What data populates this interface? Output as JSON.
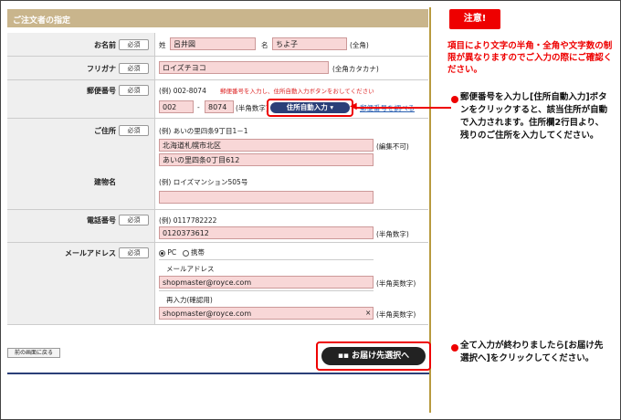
{
  "header": {
    "title": "ご注文者の指定"
  },
  "required_label": "必須",
  "name": {
    "label": "お名前",
    "sei_label": "姓",
    "sei_value": "呂井図",
    "mei_label": "名",
    "mei_value": "ちよ子",
    "hint": "(全角)"
  },
  "kana": {
    "label": "フリガナ",
    "value": "ロイズチヨコ",
    "hint": "(全角カタカナ)"
  },
  "postal": {
    "label": "郵便番号",
    "example": "(例) 002-8074",
    "instruction": "郵便番号を入力し、住所自動入力ボタンをおしてください",
    "value1": "002",
    "dash": "-",
    "value2": "8074",
    "hint": "(半角数字)",
    "auto_button": "住所自動入力",
    "lookup_link": "郵便番号を調べる"
  },
  "address": {
    "label": "ご住所",
    "example": "(例) あいの里四条9丁目1－1",
    "line1": "北海道札幌市北区",
    "line1_hint": "(編集不可)",
    "line2": "あいの里四条0丁目612",
    "building_label": "建物名",
    "building_example": "(例) ロイズマンション505号",
    "building_value": ""
  },
  "phone": {
    "label": "電話番号",
    "example": "(例) 0117782222",
    "value": "0120373612",
    "hint": "(半角数字)"
  },
  "email": {
    "label": "メールアドレス",
    "radio_pc": "PC",
    "radio_mobile": "携帯",
    "field_label": "メールアドレス",
    "value": "shopmaster@royce.com",
    "hint": "(半角英数字)",
    "confirm_label": "再入力(確認用)",
    "confirm_value": "shopmaster@royce.com",
    "confirm_hint": "(半角英数字)",
    "clear_glyph": "×"
  },
  "buttons": {
    "back": "前の画面に戻る",
    "next": "お届け先選択へ"
  },
  "notice": {
    "badge": "注意!",
    "text": "項目により文字の半角・全角や文字数の制限が異なりますのでご入力の際にご確認ください。"
  },
  "notes": {
    "postal": "郵便番号を入力し[住所自動入力]ボタンをクリックすると、該当住所が自動で入力されます。住所欄2行目より、残りのご住所を入力してください。",
    "next": "全て入力が終わりましたら[お届け先選択へ]をクリックしてください。"
  },
  "colors": {
    "accent_red": "#e00000",
    "header_gold": "#c9b58c",
    "navy": "#2b3f78",
    "field_pink": "#f8d7d7"
  }
}
